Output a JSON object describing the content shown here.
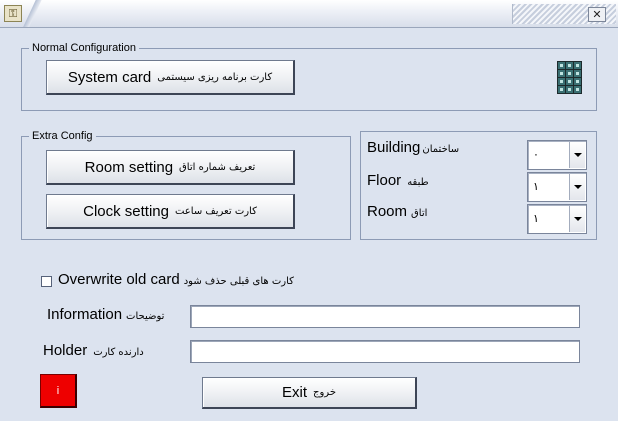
{
  "titlebar": {
    "app_icon": "key-icon",
    "close_glyph": "✕"
  },
  "normal_config": {
    "label": "Normal Configuration",
    "system_card": {
      "en": "System card",
      "fa": "کارت برنامه ریزی سیستمی"
    },
    "icon": "keypad-icon"
  },
  "extra_config": {
    "label": "Extra Config",
    "room_setting": {
      "en": "Room setting",
      "fa": "تعریف شماره اتاق"
    },
    "clock_setting": {
      "en": "Clock setting",
      "fa": "کارت تعریف ساعت"
    }
  },
  "location": {
    "building": {
      "en": "Building",
      "fa": "ساختمان",
      "value": "۰"
    },
    "floor": {
      "en": "Floor",
      "fa": "طبقه",
      "value": "۱"
    },
    "room": {
      "en": "Room",
      "fa": "اتاق",
      "value": "۱"
    }
  },
  "overwrite": {
    "en": "Overwrite old card",
    "fa": "کارت های قبلی حذف شود",
    "checked": false
  },
  "information": {
    "en": "Information",
    "fa": "توضیحات",
    "value": ""
  },
  "holder": {
    "en": "Holder",
    "fa": "دارنده کارت",
    "value": ""
  },
  "status_indicator": {
    "label": "i",
    "color": "#ee0000"
  },
  "exit_button": {
    "en": "Exit",
    "fa": "خروج"
  },
  "colors": {
    "background": "#dce3ef",
    "group_border": "#8d9bb5"
  }
}
